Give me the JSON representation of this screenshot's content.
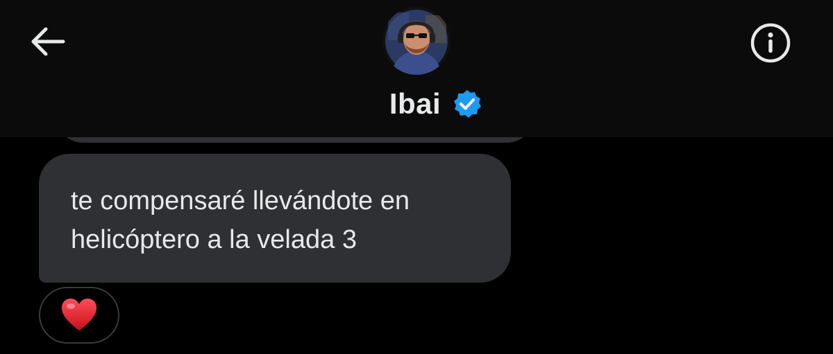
{
  "header": {
    "name": "Ibai",
    "verified": true,
    "back_icon": "arrow-left-icon",
    "info_icon": "info-icon",
    "verified_icon": "verified-badge-icon"
  },
  "messages": [
    {
      "lines": [
        "te compensaré llevándote en",
        "helicóptero a la velada 3"
      ],
      "reaction": {
        "icon": "red-heart-icon"
      }
    }
  ],
  "colors": {
    "background": "#000000",
    "header_background": "#0b0b0b",
    "bubble": "#2f3033",
    "text": "#e7e9ea",
    "verified_blue": "#1d9bf0",
    "heart": "#e0242f"
  }
}
